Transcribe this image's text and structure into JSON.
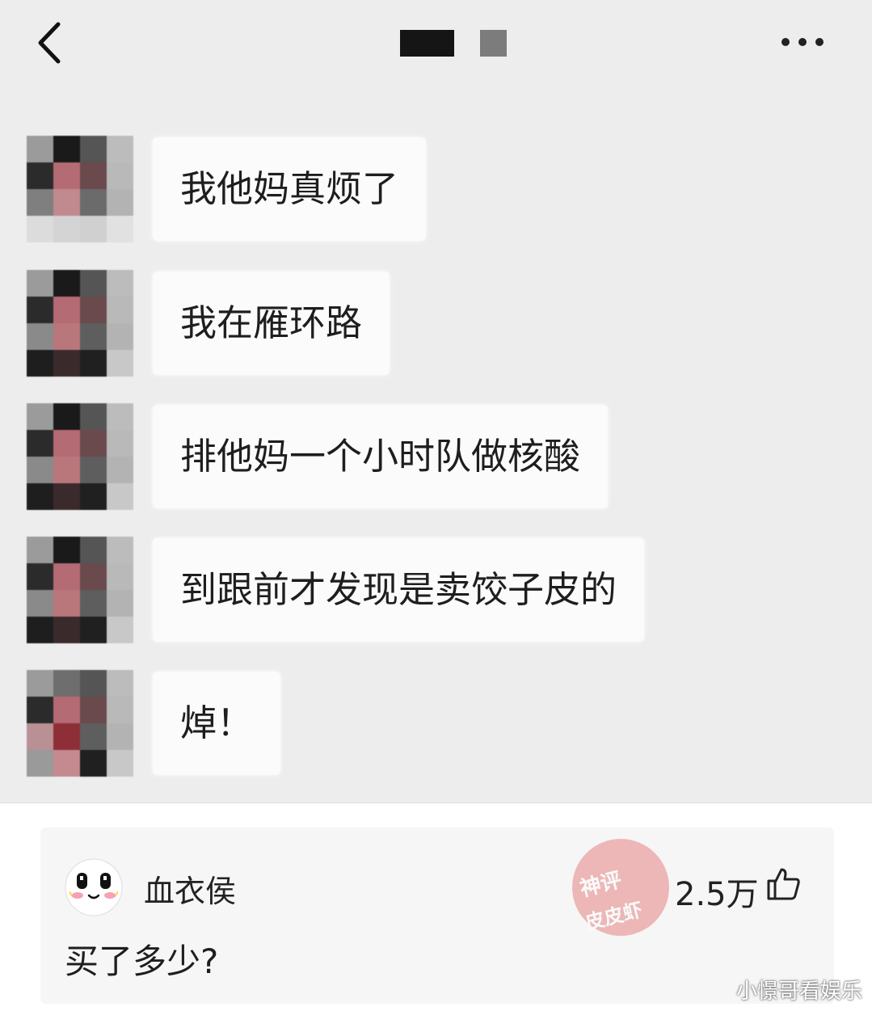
{
  "messages": [
    {
      "text": "我他妈真烦了"
    },
    {
      "text": "我在雁环路"
    },
    {
      "text": "排他妈一个小时队做核酸"
    },
    {
      "text": "到跟前才发现是卖饺子皮的"
    },
    {
      "text": "焯！"
    }
  ],
  "comment": {
    "username": "血衣侯",
    "likes": "2.5万",
    "text": "买了多少?"
  },
  "stamp": {
    "line1": "神评",
    "line2": "皮皮虾"
  },
  "watermark": "小憬哥看娱乐",
  "colors": {
    "chat_bg": "#ededed",
    "bubble": "#fbfbfb",
    "card_bg": "#f6f6f6",
    "stamp": "#e36b6b"
  },
  "icons": [
    "back-icon",
    "more-icon",
    "like-icon"
  ]
}
